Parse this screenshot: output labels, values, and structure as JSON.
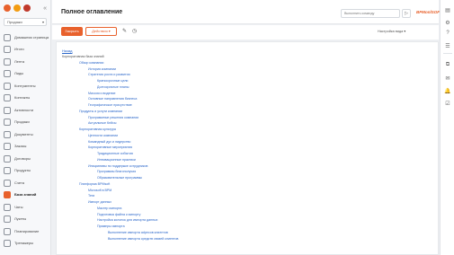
{
  "sidebar": {
    "portal_select": "Продажи",
    "items": [
      {
        "label": "Домашняя страница",
        "icon": "home-icon"
      },
      {
        "label": "Итоги",
        "icon": "dashboard-icon"
      },
      {
        "label": "Лента",
        "icon": "feed-icon"
      },
      {
        "label": "Лиды",
        "icon": "leads-icon"
      },
      {
        "label": "Контрагенты",
        "icon": "accounts-icon"
      },
      {
        "label": "Контакты",
        "icon": "contacts-icon"
      },
      {
        "label": "Активности",
        "icon": "activities-icon"
      },
      {
        "label": "Продажи",
        "icon": "opportunities-icon"
      },
      {
        "label": "Документы",
        "icon": "documents-icon"
      },
      {
        "label": "Заказы",
        "icon": "orders-icon"
      },
      {
        "label": "Договоры",
        "icon": "contracts-icon"
      },
      {
        "label": "Продукты",
        "icon": "products-icon"
      },
      {
        "label": "Счета",
        "icon": "invoices-icon"
      },
      {
        "label": "База знаний",
        "icon": "knowledge-base-icon",
        "active": true
      },
      {
        "label": "Чаты",
        "icon": "chats-icon"
      },
      {
        "label": "Лукеты",
        "icon": "bucket-icon"
      },
      {
        "label": "Планирование",
        "icon": "planning-icon"
      },
      {
        "label": "Тренажеры",
        "icon": "training-icon"
      }
    ]
  },
  "header": {
    "title": "Полное оглавление",
    "command_placeholder": "Выполнить команду",
    "brand": "BPMonlSOFT"
  },
  "toolbar": {
    "close_label": "Закрыть",
    "actions_label": "Действия ▾",
    "view_settings": "Настройка вида ▾"
  },
  "content": {
    "back_link": "Назад",
    "tree": [
      {
        "label": "Корпоративная база знаний",
        "level": 0
      },
      {
        "label": "Обзор компании",
        "level": 1
      },
      {
        "label": "История компании",
        "level": 2
      },
      {
        "label": "Стратегия роста и развития",
        "level": 2
      },
      {
        "label": "Краткосрочные цели",
        "level": 3
      },
      {
        "label": "Долгосрочные планы",
        "level": 3
      },
      {
        "label": "Миссия и видение",
        "level": 2
      },
      {
        "label": "Основные направления бизнеса",
        "level": 2
      },
      {
        "label": "Географическое присутствие",
        "level": 2
      },
      {
        "label": "Продукты и услуги компании",
        "level": 1
      },
      {
        "label": "Программные решения компании",
        "level": 2
      },
      {
        "label": "Актуальные Кейсы",
        "level": 2
      },
      {
        "label": "Корпоративная культура",
        "level": 1
      },
      {
        "label": "Ценности компании",
        "level": 2
      },
      {
        "label": "Командный дух и лидерство",
        "level": 2
      },
      {
        "label": "Корпоративные мероприятия",
        "level": 2
      },
      {
        "label": "Традиционные события",
        "level": 3
      },
      {
        "label": "Инновационные практики",
        "level": 3
      },
      {
        "label": "Инициативы по поддержке сотрудников",
        "level": 2
      },
      {
        "label": "Программы благополучия",
        "level": 3
      },
      {
        "label": "Образовательные программы",
        "level": 3
      },
      {
        "label": "Платформа BPMsoft",
        "level": 1
      },
      {
        "label": "Microsoft в BPM",
        "level": 2
      },
      {
        "label": "Теги",
        "level": 2
      },
      {
        "label": "Импорт данных",
        "level": 2
      },
      {
        "label": "Мастер импорта",
        "level": 3
      },
      {
        "label": "Подготовка файла к импорту",
        "level": 3
      },
      {
        "label": "Настройка колонок для импорта данных",
        "level": 3
      },
      {
        "label": "Примеры импорта",
        "level": 3
      },
      {
        "label": "Выполнение импорта adресов клиентов",
        "level": 4
      },
      {
        "label": "Выполнение импорта средств связей клиентов",
        "level": 4
      }
    ]
  },
  "rightbar": {
    "icons": [
      "notification-center-icon",
      "settings-icon",
      "help-icon",
      "chat-icon",
      "copy-icon",
      "email-icon",
      "bell-icon",
      "task-icon"
    ]
  },
  "colors": {
    "accent": "#e8612c",
    "link": "#2a66c9"
  }
}
